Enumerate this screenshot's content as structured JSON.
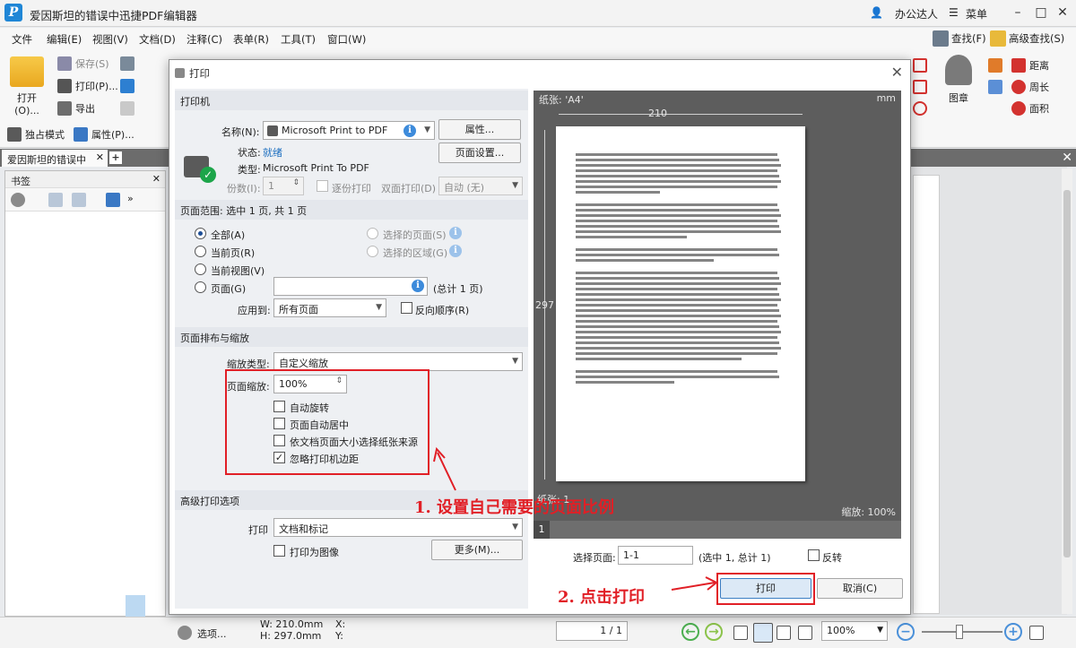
{
  "app": {
    "title": "爱因斯坦的错误中迅捷PDF编辑器",
    "logo": "P",
    "user": "办公达人",
    "menu": "菜单"
  },
  "menubar": {
    "items": [
      "文件",
      "编辑(E)",
      "视图(V)",
      "文档(D)",
      "注释(C)",
      "表单(R)",
      "工具(T)",
      "窗口(W)"
    ],
    "find": "查找(F)",
    "advanced_find": "高级查找(S)"
  },
  "ribbon": {
    "open": "打开(O)...",
    "save": "保存(S)",
    "print": "打印(P)...",
    "export": "导出",
    "exclusive_mode": "独占模式",
    "properties": "属性(P)...",
    "stamp": "图章",
    "distance": "距离",
    "perimeter": "周长",
    "area": "面积"
  },
  "tabs": {
    "doc_tab": "爱因斯坦的错误中",
    "close": "✕",
    "add": "+"
  },
  "leftpanel": {
    "title": "书签"
  },
  "dialog": {
    "title": "打印",
    "printer": {
      "section": "打印机",
      "name_label": "名称(N):",
      "name_value": "Microsoft Print to PDF",
      "properties_btn": "属性...",
      "status_label": "状态:",
      "status_value": "就绪",
      "type_label": "类型:",
      "type_value": "Microsoft Print To PDF",
      "page_setup_btn": "页面设置...",
      "copies_label": "份数(I):",
      "copies_value": "1",
      "collate": "逐份打印",
      "duplex_label": "双面打印(D)",
      "duplex_value": "自动 (无)"
    },
    "range": {
      "section": "页面范围: 选中 1 页, 共 1 页",
      "all": "全部(A)",
      "current": "当前页(R)",
      "current_view": "当前视图(V)",
      "pages": "页面(G)",
      "selected_pages": "选择的页面(S)",
      "selected_area": "选择的区域(G)",
      "total": "(总计 1 页)",
      "apply_label": "应用到:",
      "apply_value": "所有页面",
      "reverse": "反向顺序(R)"
    },
    "layout": {
      "section": "页面排布与缩放",
      "scale_type_label": "缩放类型:",
      "scale_type_value": "自定义缩放",
      "scale_label": "页面缩放:",
      "scale_value": "100%",
      "auto_rotate": "自动旋转",
      "auto_center": "页面自动居中",
      "by_doc_size": "依文档页面大小选择纸张来源",
      "ignore_margins": "忽略打印机边距",
      "ignore_margins_checked": "✓"
    },
    "advanced": {
      "section": "高级打印选项",
      "print_label": "打印",
      "print_value": "文档和标记",
      "as_image": "打印为图像",
      "more_btn": "更多(M)..."
    },
    "preview": {
      "paper": "纸张: 'A4'",
      "unit": "mm",
      "width": "210",
      "height": "297",
      "paper_count": "纸张: 1",
      "zoom": "缩放: 100%",
      "page_num": "1",
      "select_label": "选择页面:",
      "select_value": "1-1",
      "select_info": "(选中 1, 总计 1)",
      "invert": "反转"
    },
    "print_btn": "打印",
    "cancel_btn": "取消(C)"
  },
  "annotations": {
    "step1": "1. 设置自己需要的页面比例",
    "step2": "2. 点击打印"
  },
  "statusbar": {
    "options": "选项...",
    "width": "W: 210.0mm",
    "height": "H: 297.0mm",
    "x": "X:",
    "y": "Y:",
    "page": "1 / 1",
    "zoom": "100%"
  },
  "colors": {
    "accent": "#1f86d6",
    "annotation": "#e11f26",
    "preview_bg": "#5d5d5d"
  }
}
